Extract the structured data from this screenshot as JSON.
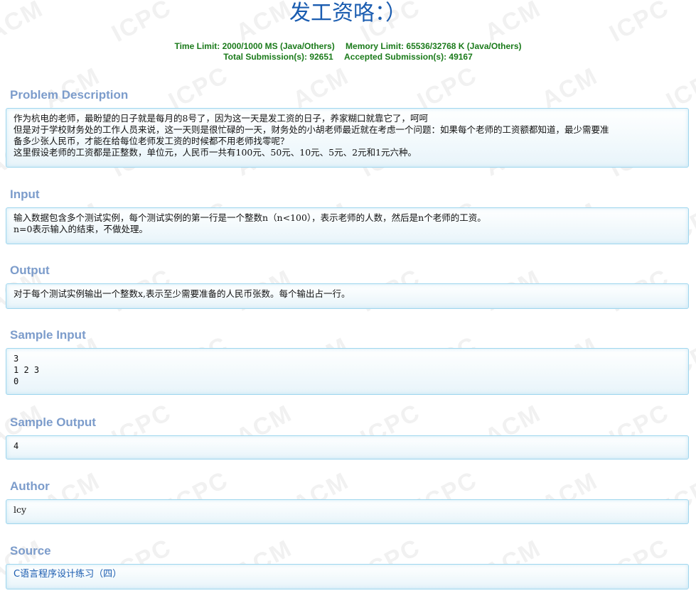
{
  "header": {
    "cut_text": "发工资咯：）",
    "title": "发工资咯：）",
    "time_limit": "Time Limit: 2000/1000 MS (Java/Others)",
    "memory_limit": "Memory Limit: 65536/32768 K (Java/Others)",
    "total_submissions": "Total Submission(s): 92651",
    "accepted_submissions": "Accepted Submission(s): 49167"
  },
  "sections": {
    "description": {
      "heading": "Problem Description",
      "lines": [
        "作为杭电的老师，最盼望的日子就是每月的8号了，因为这一天是发工资的日子，养家糊口就靠它了，呵呵",
        "但是对于学校财务处的工作人员来说，这一天则是很忙碌的一天，财务处的小胡老师最近就在考虑一个问题：如果每个老师的工资额都知道，最少需要准",
        "备多少张人民币，才能在给每位老师发工资的时候都不用老师找零呢？",
        "这里假设老师的工资都是正整数，单位元，人民币一共有100元、50元、10元、5元、2元和1元六种。"
      ]
    },
    "input": {
      "heading": "Input",
      "lines": [
        "输入数据包含多个测试实例，每个测试实例的第一行是一个整数n（n<100），表示老师的人数，然后是n个老师的工资。",
        "n=0表示输入的结束，不做处理。"
      ]
    },
    "output": {
      "heading": "Output",
      "lines": [
        "对于每个测试实例输出一个整数x,表示至少需要准备的人民币张数。每个输出占一行。"
      ]
    },
    "sample_input": {
      "heading": "Sample Input",
      "lines": [
        "3",
        "1 2 3",
        "0"
      ]
    },
    "sample_output": {
      "heading": "Sample Output",
      "lines": [
        "4"
      ]
    },
    "author": {
      "heading": "Author",
      "value": "lcy"
    },
    "source": {
      "heading": "Source",
      "value": "C语言程序设计练习（四）"
    }
  },
  "watermark": {
    "words": [
      "ACM",
      "ICPC"
    ]
  }
}
